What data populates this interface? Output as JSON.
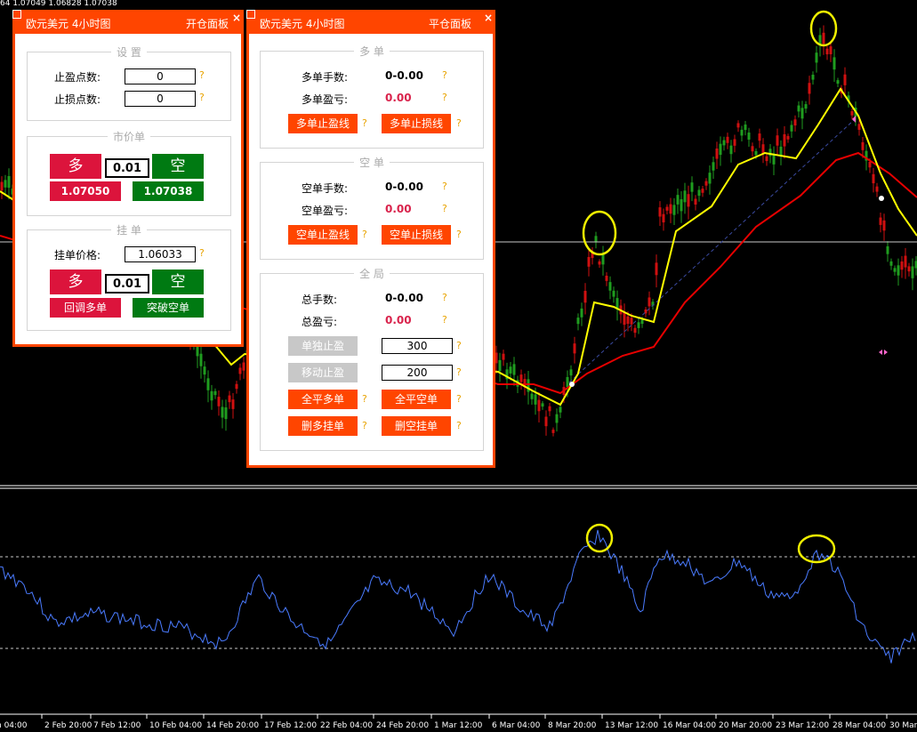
{
  "quote_line": "64 1.07049 1.06828 1.07038",
  "colors": {
    "accent": "#ff4500",
    "buy": "#dc143c",
    "sell": "#007a12",
    "question": "#e8a300",
    "pnl": "#d9234c",
    "ma_fast": "#ffff00",
    "ma_slow": "#e60000",
    "oscillator": "#4a7bff"
  },
  "x_axis_labels": [
    "n 04:00",
    "2 Feb 20:00",
    "7 Feb 12:00",
    "10 Feb 04:00",
    "14 Feb 20:00",
    "17 Feb 12:00",
    "22 Feb 04:00",
    "24 Feb 20:00",
    "1 Mar 12:00",
    "6 Mar 04:00",
    "8 Mar 20:00",
    "13 Mar 12:00",
    "16 Mar 04:00",
    "20 Mar 20:00",
    "23 Mar 12:00",
    "28 Mar 04:00",
    "30 Mar"
  ],
  "open_panel": {
    "title": "欧元美元 4小时图",
    "name": "开仓面板",
    "close": "×",
    "settings": {
      "title": "设 置",
      "tp_label": "止盈点数:",
      "tp_value": "0",
      "sl_label": "止损点数:",
      "sl_value": "0"
    },
    "market": {
      "title": "市价单",
      "buy_label": "多",
      "sell_label": "空",
      "lots": "0.01",
      "buy_price": "1.07050",
      "sell_price": "1.07038"
    },
    "pending": {
      "title": "挂 单",
      "price_label": "挂单价格:",
      "price_value": "1.06033",
      "buy_label": "多",
      "sell_label": "空",
      "lots": "0.01",
      "pullback_buy": "回调多单",
      "breakout_sell": "突破空单"
    },
    "q": "?"
  },
  "close_panel": {
    "title": "欧元美元 4小时图",
    "name": "平仓面板",
    "close": "×",
    "long": {
      "title": "多 单",
      "lots_label": "多单手数:",
      "lots_value": "0-0.00",
      "pnl_label": "多单盈亏:",
      "pnl_value": "0.00",
      "tp_line": "多单止盈线",
      "sl_line": "多单止损线"
    },
    "short": {
      "title": "空 单",
      "lots_label": "空单手数:",
      "lots_value": "0-0.00",
      "pnl_label": "空单盈亏:",
      "pnl_value": "0.00",
      "tp_line": "空单止盈线",
      "sl_line": "空单止损线"
    },
    "global": {
      "title": "全 局",
      "lots_label": "总手数:",
      "lots_value": "0-0.00",
      "pnl_label": "总盈亏:",
      "pnl_value": "0.00",
      "single_tp": "单独止盈",
      "single_tp_value": "300",
      "trailing": "移动止盈",
      "trailing_value": "200",
      "close_all_long": "全平多单",
      "close_all_short": "全平空单",
      "del_long_pending": "删多挂单",
      "del_short_pending": "删空挂单"
    },
    "q": "?"
  }
}
